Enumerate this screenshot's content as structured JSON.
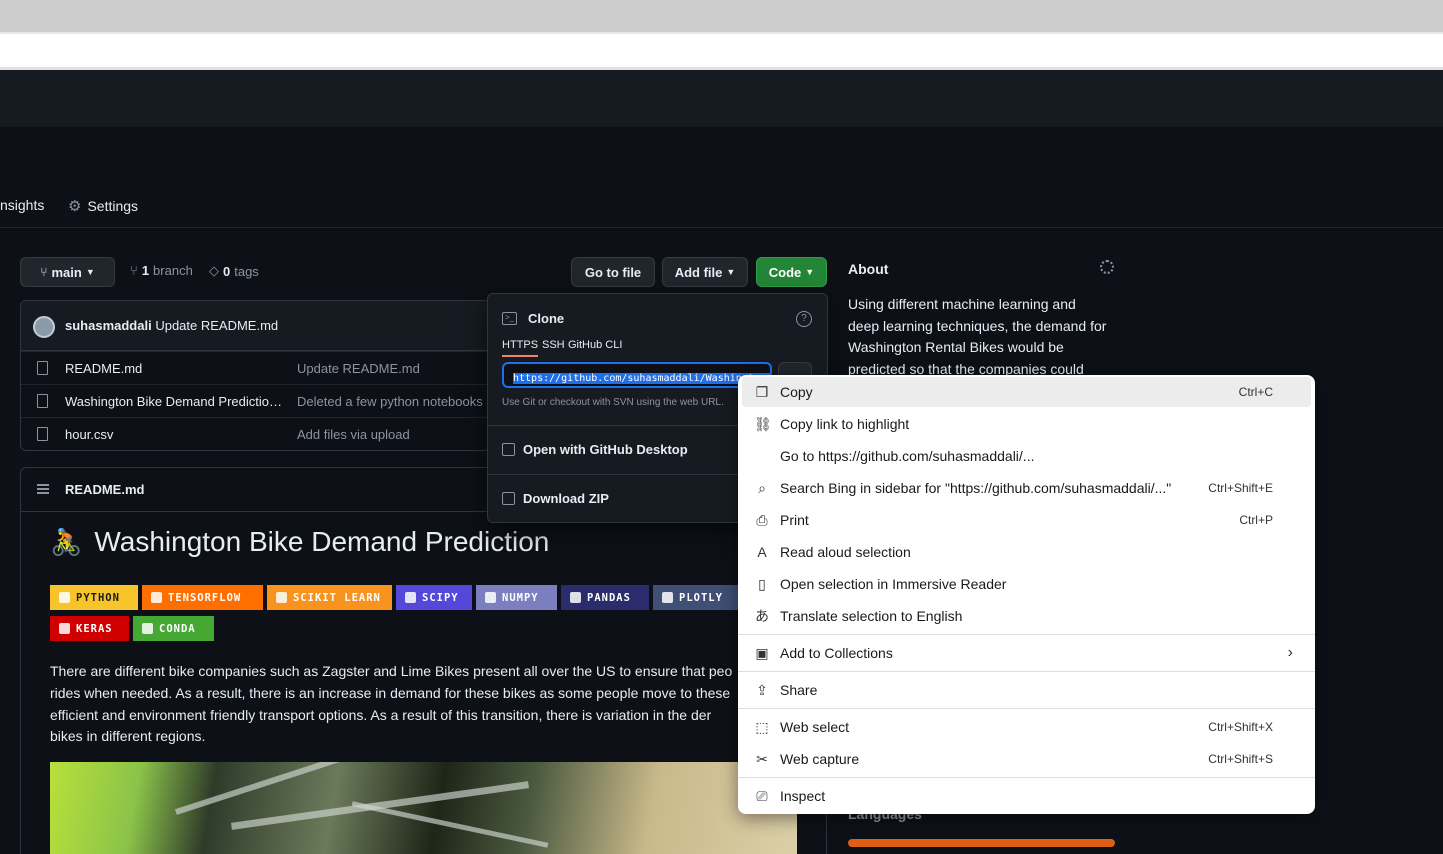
{
  "nav": {
    "insights_label": "nsights",
    "settings_label": "Settings"
  },
  "repo": {
    "branch_name": "main",
    "branch_count": "1",
    "branch_label": "branch",
    "tags_count": "0",
    "tags_label": "tags",
    "go_to_file": "Go to file",
    "add_file": "Add file",
    "code": "Code"
  },
  "commit": {
    "author": "suhasmaddali",
    "message": "Update README.md"
  },
  "files": [
    {
      "name": "README.md",
      "message": "Update README.md"
    },
    {
      "name": "Washington Bike Demand Prediction ...",
      "message": "Deleted a few python notebooks"
    },
    {
      "name": "hour.csv",
      "message": "Add files via upload"
    }
  ],
  "readme": {
    "header": "README.md",
    "title": "Washington Bike Demand Prediction",
    "emoji": "🚴",
    "badges": [
      {
        "label": "PYTHON",
        "color": "#f7c52b",
        "text_color": "#1a1a1a"
      },
      {
        "label": "TENSORFLOW",
        "color": "#ff6f00",
        "text_color": "#ffffff"
      },
      {
        "label": "SCIKIT LEARN",
        "color": "#f7931e",
        "text_color": "#ffffff"
      },
      {
        "label": "SCIPY",
        "color": "#5548d9",
        "text_color": "#ffffff"
      },
      {
        "label": "NUMPY",
        "color": "#7b7fbf",
        "text_color": "#ffffff"
      },
      {
        "label": "PANDAS",
        "color": "#2b2c6b",
        "text_color": "#ffffff"
      },
      {
        "label": "PLOTLY",
        "color": "#3f4f75",
        "text_color": "#ffffff"
      },
      {
        "label": "KERAS",
        "color": "#d00000",
        "text_color": "#ffffff"
      },
      {
        "label": "CONDA",
        "color": "#44a833",
        "text_color": "#ffffff"
      }
    ],
    "paragraph": "There are different bike companies such as Zagster and Lime Bikes present all over the US to ensure that peo rides when needed. As a result, there is an increase in demand for these bikes as some people move to these efficient and environment friendly transport options. As a result of this transition, there is variation in the der bikes in different regions."
  },
  "about": {
    "title": "About",
    "description": "Using different machine learning and deep learning techniques, the demand for Washington Rental Bikes would be predicted so that the companies could",
    "languages_title": "Languages"
  },
  "clone": {
    "title": "Clone",
    "tabs": [
      "HTTPS",
      "SSH",
      "GitHub CLI"
    ],
    "url": "https://github.com/suhasmaddali/Washington-Bike-Demand-Prediction.git",
    "hint": "Use Git or checkout with SVN using the web URL.",
    "open_desktop": "Open with GitHub Desktop",
    "download_zip": "Download ZIP"
  },
  "context_menu": {
    "items": [
      {
        "label": "Copy",
        "shortcut": "Ctrl+C",
        "icon": "copy-icon"
      },
      {
        "label": "Copy link to highlight",
        "shortcut": "",
        "icon": "link-highlight-icon"
      },
      {
        "label": "Go to https://github.com/suhasmaddali/...",
        "shortcut": "",
        "icon": ""
      },
      {
        "label": "Search Bing in sidebar for \"https://github.com/suhasmaddali/...\"",
        "shortcut": "Ctrl+Shift+E",
        "icon": "search-sidebar-icon"
      },
      {
        "label": "Print",
        "shortcut": "Ctrl+P",
        "icon": "print-icon"
      },
      {
        "label": "Read aloud selection",
        "shortcut": "",
        "icon": "read-aloud-icon"
      },
      {
        "label": "Open selection in Immersive Reader",
        "shortcut": "",
        "icon": "immersive-reader-icon"
      },
      {
        "label": "Translate selection to English",
        "shortcut": "",
        "icon": "translate-icon"
      },
      {
        "label": "Add to Collections",
        "shortcut": "",
        "icon": "collections-icon"
      },
      {
        "label": "Share",
        "shortcut": "",
        "icon": "share-icon"
      },
      {
        "label": "Web select",
        "shortcut": "Ctrl+Shift+X",
        "icon": "web-select-icon"
      },
      {
        "label": "Web capture",
        "shortcut": "Ctrl+Shift+S",
        "icon": "web-capture-icon"
      },
      {
        "label": "Inspect",
        "shortcut": "",
        "icon": "inspect-icon"
      }
    ]
  },
  "colors": {
    "background": "#0d1117",
    "accent_green": "#238636",
    "selection_blue": "#1f6feb",
    "language_bar": "#dd5e15"
  }
}
